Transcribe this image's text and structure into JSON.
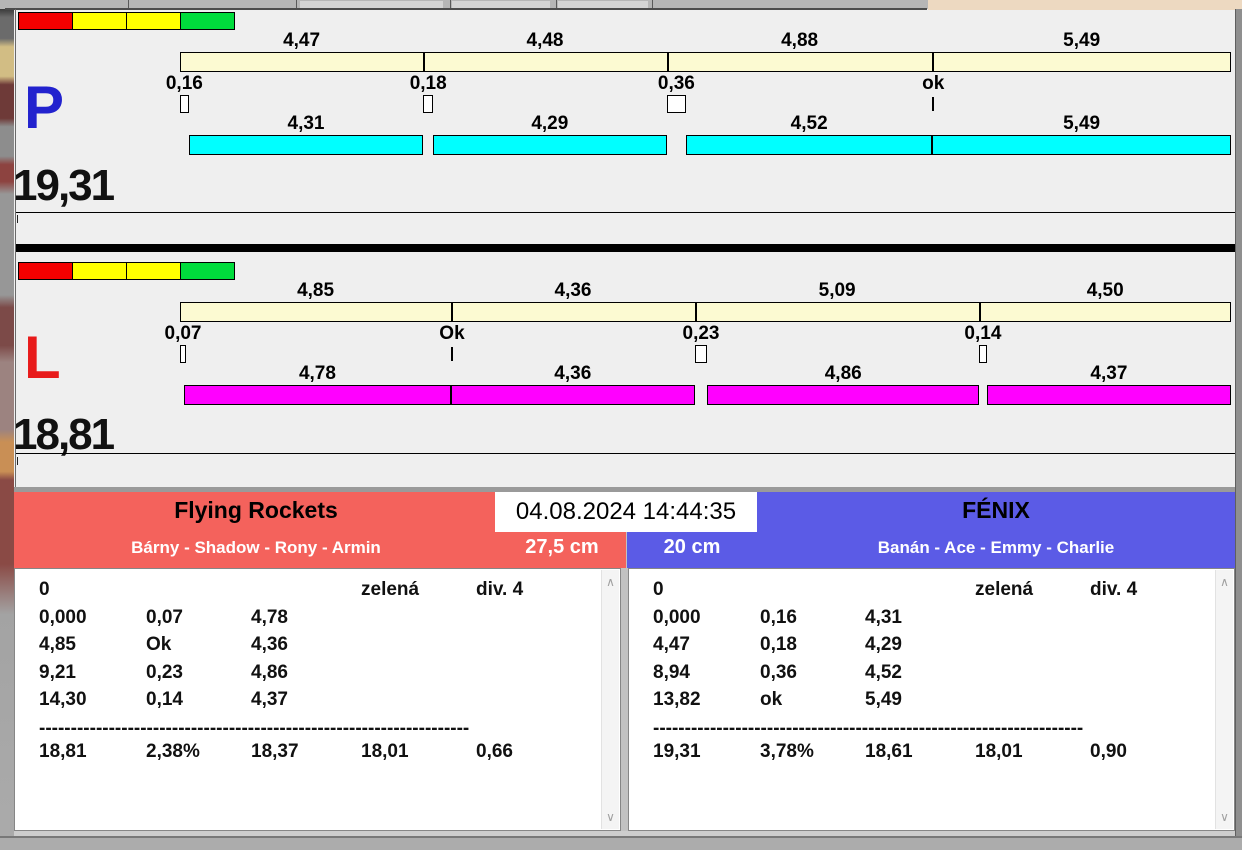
{
  "icons": {
    "scroll_up": "∧",
    "scroll_down": "∨"
  },
  "lanes": [
    {
      "id": "P",
      "letter": "P",
      "letter_color": "#2222CE",
      "total_label": "19,31",
      "run_bar_color": "#00FFFF",
      "traffic_lights": [
        "#F40000",
        "#FFFF00",
        "#FFFF00",
        "#00DC3C"
      ],
      "splits": [
        {
          "label": "4,47",
          "value": 4.47
        },
        {
          "label": "4,48",
          "value": 4.48
        },
        {
          "label": "4,88",
          "value": 4.88
        },
        {
          "label": "5,49",
          "value": 5.49
        }
      ],
      "crossings": [
        {
          "label": "0,16",
          "value": 0.16
        },
        {
          "label": "0,18",
          "value": 0.18
        },
        {
          "label": "0,36",
          "value": 0.36
        },
        {
          "label": "ok",
          "value": 0
        }
      ],
      "runs": [
        {
          "label": "4,31",
          "value": 4.31
        },
        {
          "label": "4,29",
          "value": 4.29
        },
        {
          "label": "4,52",
          "value": 4.52
        },
        {
          "label": "5,49",
          "value": 5.49
        }
      ]
    },
    {
      "id": "L",
      "letter": "L",
      "letter_color": "#E81A1A",
      "total_label": "18,81",
      "run_bar_color": "#FF00FF",
      "traffic_lights": [
        "#F40000",
        "#FFFF00",
        "#FFFF00",
        "#00DC3C"
      ],
      "splits": [
        {
          "label": "4,85",
          "value": 4.85
        },
        {
          "label": "4,36",
          "value": 4.36
        },
        {
          "label": "5,09",
          "value": 5.09
        },
        {
          "label": "4,50",
          "value": 4.5
        }
      ],
      "crossings": [
        {
          "label": "0,07",
          "value": 0.07
        },
        {
          "label": "Ok",
          "value": 0
        },
        {
          "label": "0,23",
          "value": 0.23
        },
        {
          "label": "0,14",
          "value": 0.14
        }
      ],
      "runs": [
        {
          "label": "4,78",
          "value": 4.78
        },
        {
          "label": "4,36",
          "value": 4.36
        },
        {
          "label": "4,86",
          "value": 4.86
        },
        {
          "label": "4,37",
          "value": 4.37
        }
      ]
    }
  ],
  "scoreboard": {
    "timestamp": "04.08.2024 14:44:35",
    "panels": [
      {
        "side": "left",
        "team": "Flying Rockets",
        "dogs": "Bárny - Shadow - Rony - Armin",
        "height": "27,5 cm",
        "header_color": "#F4625C",
        "rows": [
          [
            "0",
            "",
            "",
            "zelená",
            "div. 4"
          ],
          [
            "0,000",
            "0,07",
            "4,78",
            "",
            ""
          ],
          [
            "4,85",
            "Ok",
            "4,36",
            "",
            ""
          ],
          [
            "9,21",
            "0,23",
            "4,86",
            "",
            ""
          ],
          [
            "14,30",
            "0,14",
            "4,37",
            "",
            ""
          ]
        ],
        "dashes": "--------------------------------------------------------------------",
        "summary": [
          "18,81",
          "2,38%",
          "18,37",
          "18,01",
          "0,66"
        ]
      },
      {
        "side": "right",
        "team": "FÉNIX",
        "dogs": "Banán - Ace - Emmy - Charlie",
        "height": "20 cm",
        "header_color": "#5B5BE6",
        "rows": [
          [
            "0",
            "",
            "",
            "zelená",
            "div. 4"
          ],
          [
            "0,000",
            "0,16",
            "4,31",
            "",
            ""
          ],
          [
            "4,47",
            "0,18",
            "4,29",
            "",
            ""
          ],
          [
            "8,94",
            "0,36",
            "4,52",
            "",
            ""
          ],
          [
            "13,82",
            "ok",
            "5,49",
            "",
            ""
          ]
        ],
        "dashes": "--------------------------------------------------------------------",
        "summary": [
          "19,31",
          "3,78%",
          "18,61",
          "18,01",
          "0,90"
        ]
      }
    ]
  }
}
